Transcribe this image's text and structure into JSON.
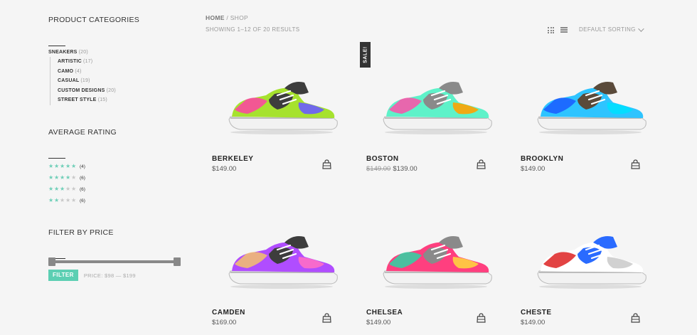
{
  "sidebar": {
    "categories": {
      "title": "Product Categories",
      "parent": {
        "label": "Sneakers",
        "count": "(20)"
      },
      "children": [
        {
          "label": "Artistic",
          "count": "(17)"
        },
        {
          "label": "Camo",
          "count": "(4)"
        },
        {
          "label": "Casual",
          "count": "(19)"
        },
        {
          "label": "Custom Designs",
          "count": "(20)"
        },
        {
          "label": "Street Style",
          "count": "(15)"
        }
      ]
    },
    "rating": {
      "title": "Average Rating",
      "rows": [
        {
          "stars": 5,
          "count": "(4)"
        },
        {
          "stars": 4,
          "count": "(6)"
        },
        {
          "stars": 3,
          "count": "(6)"
        },
        {
          "stars": 2,
          "count": "(6)"
        }
      ]
    },
    "price": {
      "title": "Filter by Price",
      "filter_label": "FILTER",
      "price_label": "PRICE: $98 — $199"
    }
  },
  "header": {
    "breadcrumb_home": "HOME",
    "breadcrumb_rest": " / SHOP",
    "results": "SHOWING 1–12 OF 20 RESULTS",
    "sorting": "DEFAULT SORTING"
  },
  "products": [
    {
      "name": "BERKELEY",
      "price": "$149.00",
      "old_price": ""
    },
    {
      "name": "BOSTON",
      "price": "$139.00",
      "old_price": "$149.00",
      "badge": "SALE!"
    },
    {
      "name": "BROOKLYN",
      "price": "$149.00",
      "old_price": ""
    },
    {
      "name": "CAMDEN",
      "price": "$169.00",
      "old_price": ""
    },
    {
      "name": "CHELSEA",
      "price": "$149.00",
      "old_price": ""
    },
    {
      "name": "CHESTE",
      "price": "$149.00",
      "old_price": ""
    }
  ],
  "colors": {
    "accent": "#5ccfb3",
    "star_on": "#6fcfb8",
    "star_off": "#c8c8c8",
    "badge_bg": "#333333"
  },
  "icons": {
    "cart": "shopping-bag-icon",
    "grid": "grid-view-icon",
    "list": "list-view-icon",
    "star": "star-icon"
  }
}
